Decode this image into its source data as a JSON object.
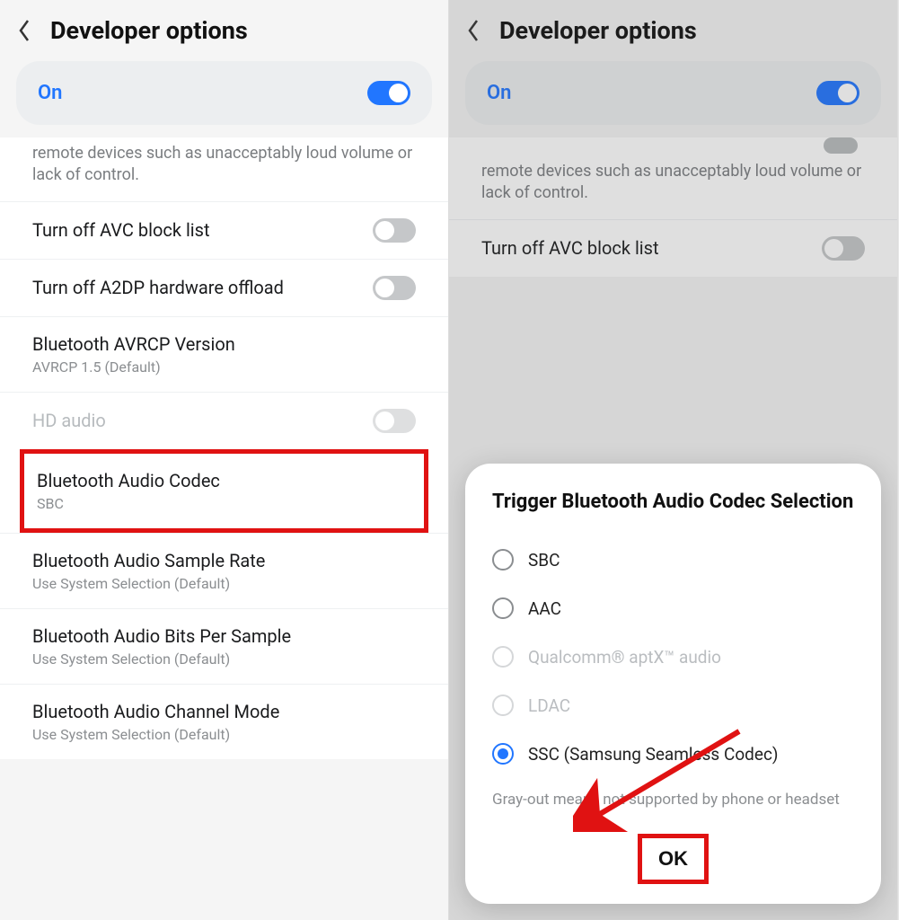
{
  "left": {
    "header": {
      "title": "Developer options"
    },
    "master_toggle": {
      "label": "On",
      "on": true
    },
    "partial_text": "remote devices such as unacceptably loud volume or lack of control.",
    "items": [
      {
        "title": "Turn off AVC block list",
        "sub": "",
        "switch": "off"
      },
      {
        "title": "Turn off A2DP hardware offload",
        "sub": "",
        "switch": "off"
      },
      {
        "title": "Bluetooth AVRCP Version",
        "sub": "AVRCP 1.5 (Default)"
      },
      {
        "title": "HD audio",
        "sub": "",
        "switch": "disabled",
        "disabled": true
      },
      {
        "title": "Bluetooth Audio Codec",
        "sub": "SBC",
        "highlighted": true
      },
      {
        "title": "Bluetooth Audio Sample Rate",
        "sub": "Use System Selection (Default)"
      },
      {
        "title": "Bluetooth Audio Bits Per Sample",
        "sub": "Use System Selection (Default)"
      },
      {
        "title": "Bluetooth Audio Channel Mode",
        "sub": "Use System Selection (Default)"
      }
    ]
  },
  "right": {
    "header": {
      "title": "Developer options"
    },
    "master_toggle": {
      "label": "On",
      "on": true
    },
    "partial_text": "remote devices such as unacceptably loud volume or lack of control.",
    "items": [
      {
        "title": "Turn off AVC block list",
        "sub": "",
        "switch": "off"
      }
    ],
    "dialog": {
      "title": "Trigger Bluetooth Audio Codec Selection",
      "options": [
        {
          "label": "SBC",
          "selected": false,
          "disabled": false
        },
        {
          "label": "AAC",
          "selected": false,
          "disabled": false
        },
        {
          "label": "Qualcomm® aptX™ audio",
          "selected": false,
          "disabled": true
        },
        {
          "label": "LDAC",
          "selected": false,
          "disabled": true
        },
        {
          "label": "SSC (Samsung Seamless Codec)",
          "selected": true,
          "disabled": false
        }
      ],
      "note": "Gray-out means not supported by phone or headset",
      "ok": "OK"
    }
  }
}
